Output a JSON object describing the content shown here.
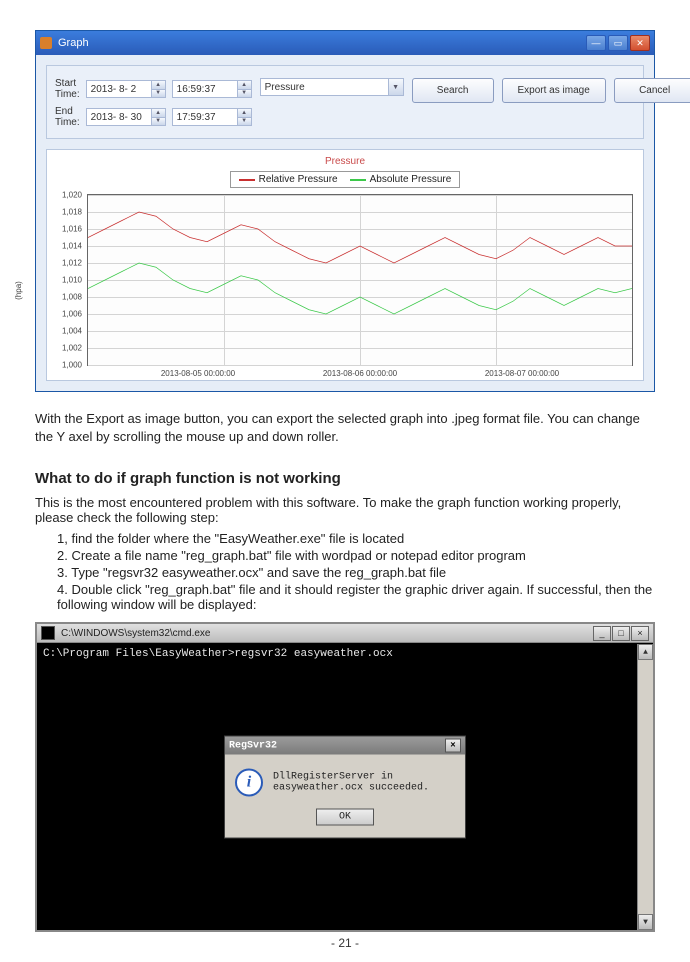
{
  "graphWindow": {
    "title": "Graph",
    "startTimeLabel": "Start Time:",
    "endTimeLabel": "End Time:",
    "startDate": "2013- 8- 2",
    "startTime": "16:59:37",
    "endDate": "2013- 8- 30",
    "endTime": "17:59:37",
    "dropdown": "Pressure",
    "searchBtn": "Search",
    "exportBtn": "Export as image",
    "cancelBtn": "Cancel"
  },
  "chart_data": {
    "type": "line",
    "title": "Pressure",
    "ylabel": "(hpa)",
    "xlabel": "",
    "ylim": [
      1000,
      1020
    ],
    "y_ticks": [
      1000,
      1002,
      1004,
      1006,
      1008,
      1010,
      1012,
      1014,
      1016,
      1018,
      1020
    ],
    "x_ticks": [
      "2013-08-05 00:00:00",
      "2013-08-06 00:00:00",
      "2013-08-07 00:00:00"
    ],
    "legend": [
      {
        "name": "Relative Pressure",
        "color": "#c93030"
      },
      {
        "name": "Absolute Pressure",
        "color": "#3cc94a"
      }
    ],
    "series": [
      {
        "name": "Relative Pressure",
        "color": "#c93030",
        "values": [
          1015,
          1016,
          1017,
          1018,
          1017.5,
          1016,
          1015,
          1014.5,
          1015.5,
          1016.5,
          1016,
          1014.5,
          1013.5,
          1012.5,
          1012,
          1013,
          1014,
          1013,
          1012,
          1013,
          1014,
          1015,
          1014,
          1013,
          1012.5,
          1013.5,
          1015,
          1014,
          1013,
          1014,
          1015,
          1014,
          1014
        ]
      },
      {
        "name": "Absolute Pressure",
        "color": "#3cc94a",
        "values": [
          1009,
          1010,
          1011,
          1012,
          1011.5,
          1010,
          1009,
          1008.5,
          1009.5,
          1010.5,
          1010,
          1008.5,
          1007.5,
          1006.5,
          1006,
          1007,
          1008,
          1007,
          1006,
          1007,
          1008,
          1009,
          1008,
          1007,
          1006.5,
          1007.5,
          1009,
          1008,
          1007,
          1008,
          1009,
          1008.5,
          1009
        ]
      }
    ]
  },
  "bodyText": {
    "p1": "With the Export as image button, you can export the selected graph into .jpeg format file. You can change the Y axel by scrolling the mouse up and down roller.",
    "heading": "What to do if graph function is not working",
    "p2": "This is the most encountered problem with this software. To make the graph function working properly, please check the following step:",
    "steps": [
      "1, find the folder where the \"EasyWeather.exe\" file is located",
      "2. Create a file name \"reg_graph.bat\" file with wordpad or notepad editor program",
      "3. Type \"regsvr32 easyweather.ocx\" and save the reg_graph.bat file",
      "4. Double click \"reg_graph.bat\" file and it should register the graphic driver again. If successful, then the following window will be displayed:"
    ]
  },
  "cmdWindow": {
    "title": "C:\\WINDOWS\\system32\\cmd.exe",
    "line": "C:\\Program Files\\EasyWeather>regsvr32 easyweather.ocx",
    "dialogTitle": "RegSvr32",
    "dialogMsg": "DllRegisterServer in easyweather.ocx succeeded.",
    "okBtn": "OK"
  },
  "pageNum": "- 21 -"
}
